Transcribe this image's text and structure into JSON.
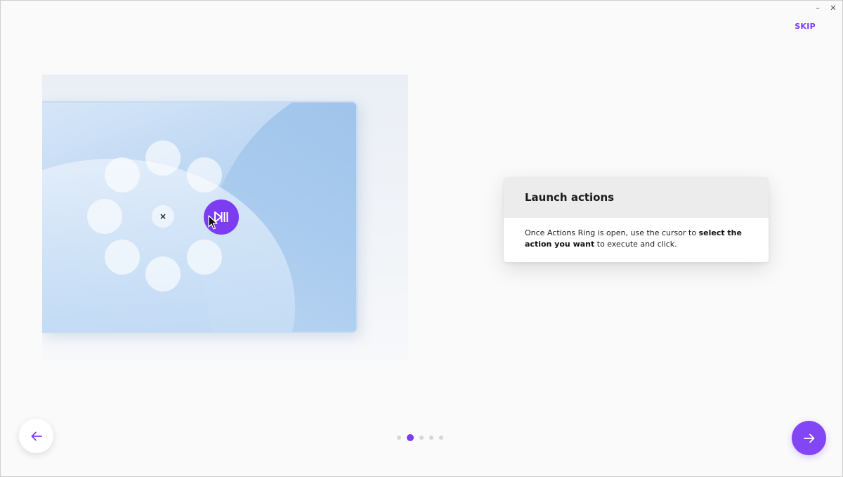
{
  "window": {
    "minimize_glyph": "–",
    "close_glyph": "✕"
  },
  "header": {
    "skip_label": "SKIP"
  },
  "illustration": {
    "center_close_glyph": "×",
    "active_action_icon": "play-pause-icon",
    "accent_color": "#7c3cf2"
  },
  "card": {
    "title": "Launch actions",
    "body_part1": "Once Actions Ring is open, use the cursor to ",
    "body_bold": "select the action you want",
    "body_part2": " to execute and click."
  },
  "navigation": {
    "back_icon": "arrow-left-icon",
    "next_icon": "arrow-right-icon",
    "pages_total": 5,
    "current_page": 2
  }
}
